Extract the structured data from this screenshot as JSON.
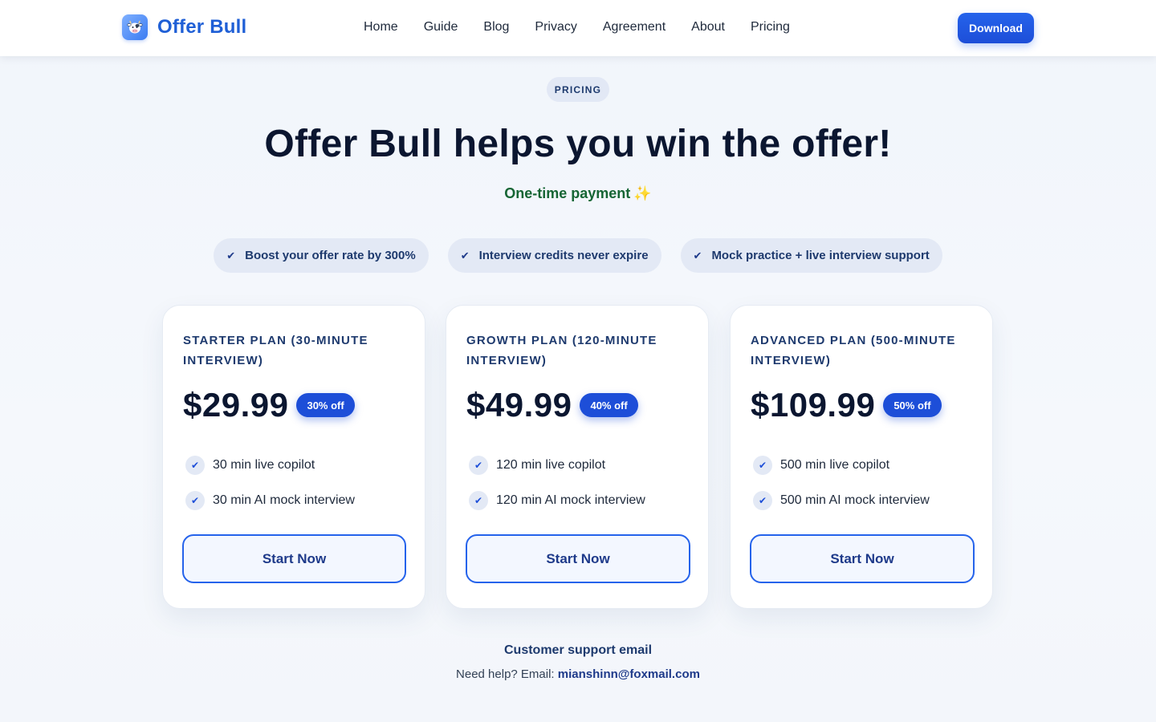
{
  "brand": {
    "name": "Offer Bull",
    "logo_icon": "cow-icon"
  },
  "nav": {
    "items": [
      "Home",
      "Guide",
      "Blog",
      "Privacy",
      "Agreement",
      "About",
      "Pricing"
    ]
  },
  "header": {
    "download_label": "Download"
  },
  "hero": {
    "badge": "PRICING",
    "title": "Offer Bull helps you win the offer!",
    "subtitle": "One-time payment",
    "subtitle_emoji": "✨"
  },
  "features": [
    "Boost your offer rate by 300%",
    "Interview credits never expire",
    "Mock practice + live interview support"
  ],
  "plans": [
    {
      "name": "Starter Plan (30-minute interview)",
      "price": "$29.99",
      "discount": "30% off",
      "items": [
        "30 min live copilot",
        "30 min AI mock interview"
      ],
      "cta": "Start Now"
    },
    {
      "name": "Growth Plan (120-minute interview)",
      "price": "$49.99",
      "discount": "40% off",
      "items": [
        "120 min live copilot",
        "120 min AI mock interview"
      ],
      "cta": "Start Now"
    },
    {
      "name": "Advanced Plan (500-minute interview)",
      "price": "$109.99",
      "discount": "50% off",
      "items": [
        "500 min live copilot",
        "500 min AI mock interview"
      ],
      "cta": "Start Now"
    }
  ],
  "support": {
    "title": "Customer support email",
    "prefix": "Need help? Email:",
    "email": "mianshinn@foxmail.com"
  },
  "colors": {
    "accent": "#1d4ed8",
    "brand": "#1f5fd6",
    "subtitle_green": "#166534",
    "chip_bg": "#e3e9f5"
  }
}
